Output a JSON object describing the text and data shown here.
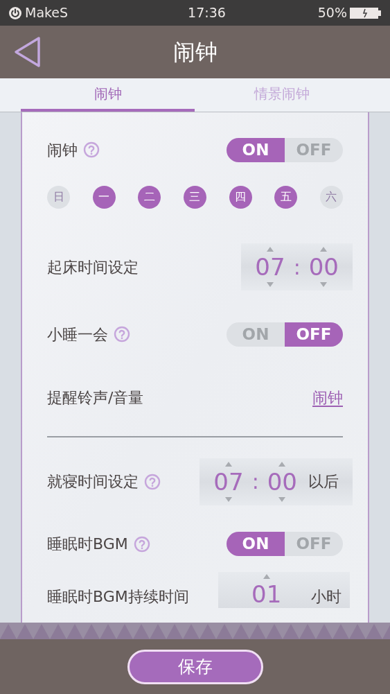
{
  "status_bar": {
    "app": "MakeS",
    "time": "17:36",
    "battery": "50%"
  },
  "header": {
    "title": "闹钟"
  },
  "tabs": [
    {
      "label": "闹钟",
      "selected": true
    },
    {
      "label": "情景闹钟",
      "selected": false
    }
  ],
  "settings": [
    {
      "kind": "toggle",
      "label": "闹钟",
      "help": true,
      "on": true,
      "on_label": "ON",
      "off_label": "OFF"
    },
    {
      "kind": "days",
      "days": [
        {
          "label": "日",
          "selected": false
        },
        {
          "label": "一",
          "selected": true
        },
        {
          "label": "二",
          "selected": true
        },
        {
          "label": "三",
          "selected": true
        },
        {
          "label": "四",
          "selected": true
        },
        {
          "label": "五",
          "selected": true
        },
        {
          "label": "六",
          "selected": false
        }
      ]
    },
    {
      "kind": "time",
      "label": "起床时间设定",
      "hour": "07",
      "separator": ":",
      "minute": "00"
    },
    {
      "kind": "toggle",
      "label": "小睡一会",
      "help": true,
      "on": false,
      "on_label": "ON",
      "off_label": "OFF"
    },
    {
      "kind": "link",
      "label": "提醒铃声/音量",
      "value": "闹钟"
    },
    {
      "kind": "divider"
    },
    {
      "kind": "time",
      "label": "就寝时间设定",
      "help": true,
      "hour": "07",
      "separator": ":",
      "minute": "00",
      "suffix": "以后"
    },
    {
      "kind": "toggle",
      "label": "睡眠时BGM",
      "help": true,
      "on": true,
      "on_label": "ON",
      "off_label": "OFF"
    },
    {
      "kind": "duration",
      "label": "睡眠时BGM持续时间",
      "value": "01",
      "suffix": "小时"
    }
  ],
  "save_button": "保存"
}
